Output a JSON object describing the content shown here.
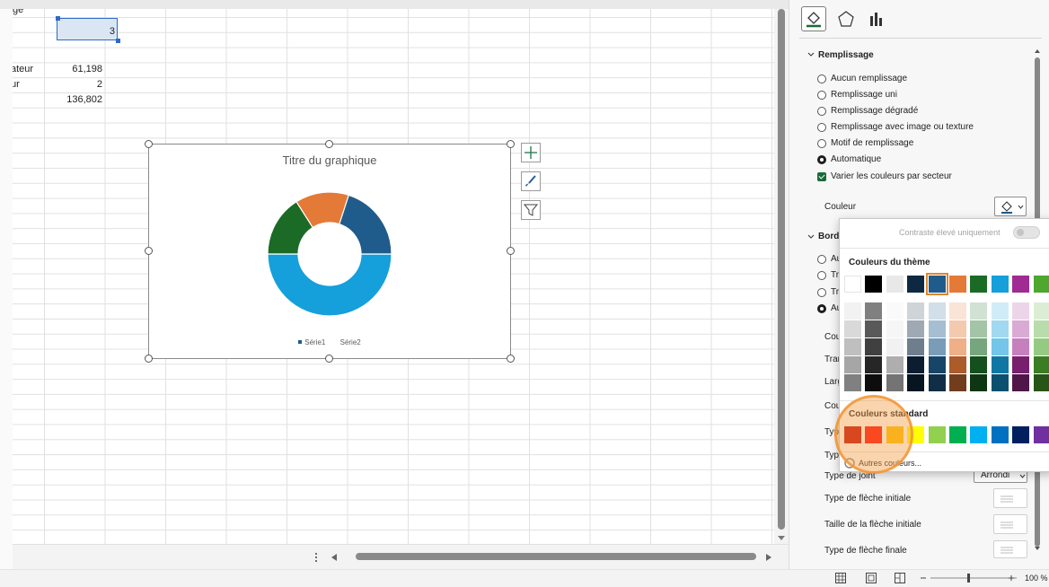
{
  "sheet": {
    "cells": {
      "c3": "3",
      "r_label1": "ateur",
      "r_val1": "61,198",
      "r_label2": "ur",
      "r_val2": "2",
      "r_val3": "136,802",
      "top_partial": "ge"
    }
  },
  "chart": {
    "title": "Titre du graphique",
    "legend": [
      "Série1",
      "Série2"
    ]
  },
  "chart_data": {
    "type": "pie",
    "title": "Titre du graphique",
    "series": [
      {
        "name": "Série1",
        "values": [
          0.5,
          0.16,
          0.14,
          0.2
        ]
      }
    ],
    "colors": [
      "#159fdb",
      "#1b6b26",
      "#e47a37",
      "#1f5c8b"
    ],
    "legend": [
      "Série1",
      "Série2"
    ],
    "legend_position": "bottom",
    "donut": true
  },
  "pane": {
    "tabs": [
      "paint-bucket-icon",
      "pentagon-icon",
      "bar-chart-icon"
    ],
    "fill_section": "Remplissage",
    "fill_options": [
      "Aucun remplissage",
      "Remplissage uni",
      "Remplissage dégradé",
      "Remplissage avec image ou texture",
      "Motif de remplissage",
      "Automatique"
    ],
    "vary_colors": "Varier les couleurs par secteur",
    "color_label": "Couleur",
    "border_section": "Bord",
    "border_partial": [
      "Au",
      "Tr",
      "Tr",
      "Au"
    ],
    "border_props_partial": [
      "Cou",
      "Tran",
      "Larg",
      "Cou",
      "Typ",
      "Typ"
    ],
    "join_type": "Type de joint",
    "join_value": "Arrondi",
    "arrow_start_type": "Type de flèche initiale",
    "arrow_start_size": "Taille de la flèche initiale",
    "arrow_end_type": "Type de flèche finale"
  },
  "popup": {
    "contrast_label": "Contraste élevé uniquement",
    "theme_colors_label": "Couleurs du thème",
    "standard_colors_label": "Couleurs standard",
    "more_colors": "Autres couleurs...",
    "theme_colors": [
      "#ffffff",
      "#000000",
      "#e8e8e8",
      "#0e2841",
      "#1f5c8b",
      "#e47a37",
      "#1b6b26",
      "#159fdb",
      "#a02b93",
      "#4ea72e"
    ],
    "standard_colors": [
      "#c00000",
      "#ff0000",
      "#ffc000",
      "#ffff00",
      "#92d050",
      "#00b050",
      "#00b0f0",
      "#0070c0",
      "#002060",
      "#7030a0"
    ]
  },
  "status": {
    "zoom": "100 %"
  }
}
